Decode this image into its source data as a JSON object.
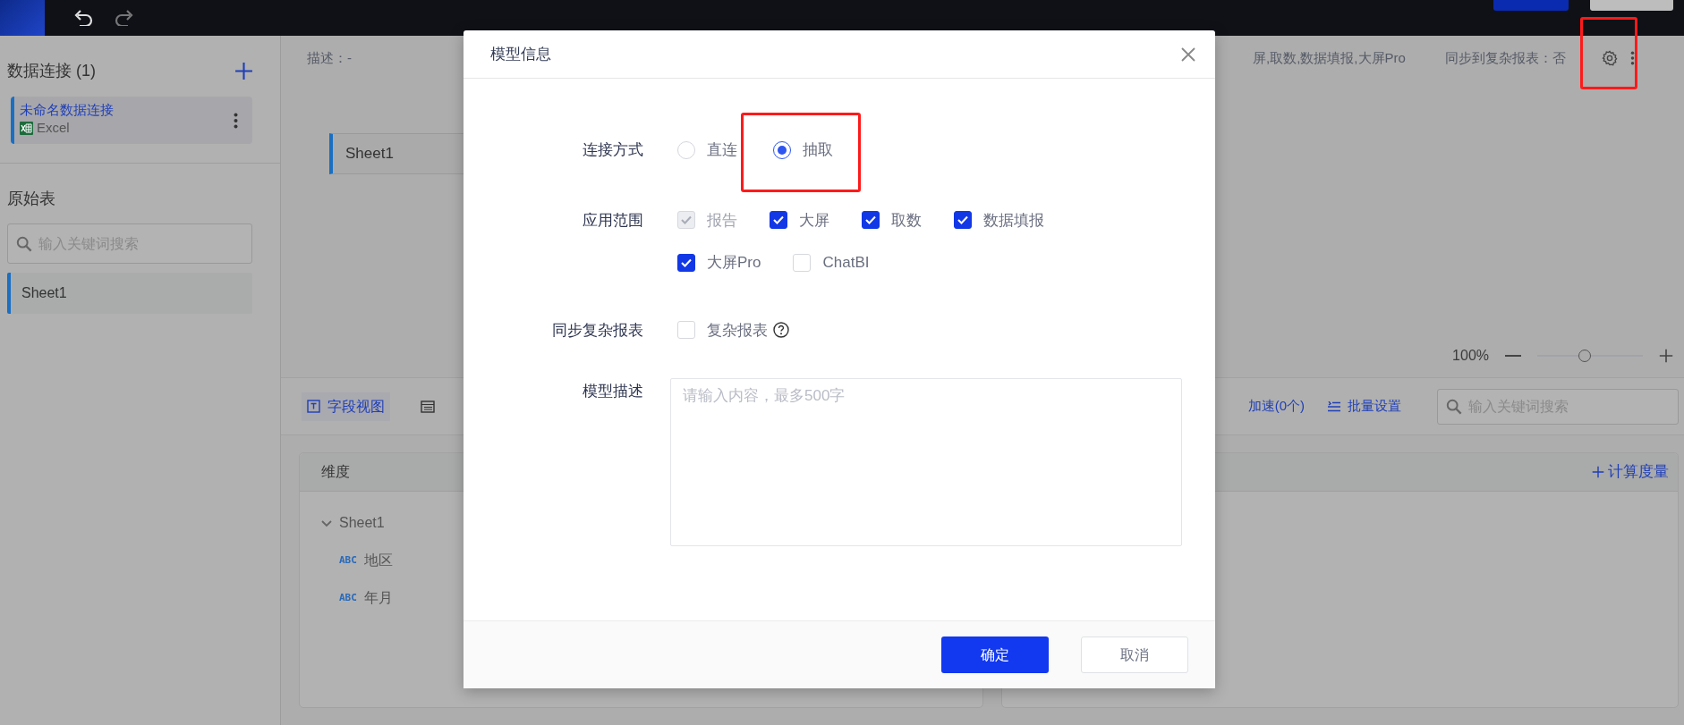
{
  "sidebar": {
    "connections_title": "数据连接 (1)",
    "connections": [
      {
        "name": "未命名数据连接",
        "type": "Excel",
        "selected": true
      }
    ],
    "tables_title": "原始表",
    "search": {
      "placeholder": "输入关键词搜索"
    },
    "tables": [
      {
        "name": "Sheet1",
        "selected": true
      }
    ]
  },
  "info_bar": {
    "description": "描述：-",
    "scope": "屏,取数,数据填报,大屏Pro",
    "sync": "同步到复杂报表：否",
    "settings_highlighted": true
  },
  "canvas": {
    "nodes": [
      {
        "name": "Sheet1"
      }
    ],
    "zoom": {
      "reading": "100%",
      "level": 0.45
    }
  },
  "view_tabs": [
    {
      "kind": "field",
      "label": "字段视图",
      "selected": true
    },
    {
      "kind": "table",
      "selected": false
    }
  ],
  "actions": [
    {
      "kind": "text",
      "label": "加速(0个)"
    },
    {
      "kind": "batch",
      "label": "批量设置"
    }
  ],
  "field_search": {
    "placeholder": "输入关键词搜索"
  },
  "dimensions": {
    "title": "维度",
    "tree": [
      {
        "label": "Sheet1",
        "expanded": true,
        "children": [
          {
            "label": "地区",
            "type_label": "ABC"
          },
          {
            "label": "年月",
            "type_label": "ABC"
          }
        ]
      }
    ]
  },
  "measures": {
    "add_label": "计算度量"
  },
  "dialog": {
    "title": "模型信息",
    "fields": [
      {
        "kind": "radio",
        "label": "连接方式",
        "options": [
          {
            "label": "直连",
            "selected": false,
            "highlighted": false
          },
          {
            "label": "抽取",
            "selected": true,
            "highlighted": true
          }
        ]
      },
      {
        "kind": "checkbox",
        "label": "应用范围",
        "help": false,
        "options": [
          {
            "label": "报告",
            "checked": true,
            "disabled": true
          },
          {
            "label": "大屏",
            "checked": true,
            "disabled": false
          },
          {
            "label": "取数",
            "checked": true,
            "disabled": false
          },
          {
            "label": "数据填报",
            "checked": true,
            "disabled": false
          },
          {
            "label": "大屏Pro",
            "checked": true,
            "disabled": false
          },
          {
            "label": "ChatBI",
            "checked": false,
            "disabled": false
          }
        ]
      },
      {
        "kind": "checkbox",
        "label": "同步复杂报表",
        "help": true,
        "options": [
          {
            "label": "复杂报表",
            "checked": false,
            "disabled": false
          }
        ]
      },
      {
        "kind": "textarea",
        "label": "模型描述",
        "placeholder": "请输入内容，最多500字"
      }
    ],
    "buttons": [
      {
        "kind": "primary",
        "label": "确定"
      },
      {
        "kind": "secondary",
        "label": "取消"
      }
    ]
  }
}
